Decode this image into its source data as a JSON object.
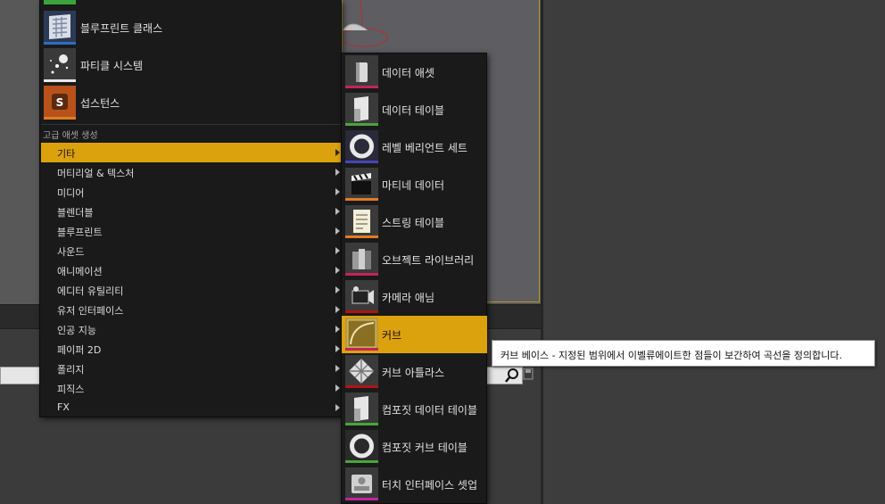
{
  "main_menu": {
    "assets": [
      {
        "label": "블루프린트 클래스",
        "icon": "blueprint-class-icon",
        "color": "#2f6cc8"
      },
      {
        "label": "파티클 시스템",
        "icon": "particle-system-icon",
        "color": "#e8e8e8"
      },
      {
        "label": "섭스턴스",
        "icon": "substance-icon",
        "color": "#e07d22"
      }
    ],
    "section_header": "고급 애셋 생성",
    "categories": [
      {
        "label": "기타",
        "active": true
      },
      {
        "label": "머티리얼 & 텍스처"
      },
      {
        "label": "미디어"
      },
      {
        "label": "블렌더블"
      },
      {
        "label": "블루프린트"
      },
      {
        "label": "사운드"
      },
      {
        "label": "애니메이션"
      },
      {
        "label": "에디터 유틸리티"
      },
      {
        "label": "유저 인터페이스"
      },
      {
        "label": "인공 지능"
      },
      {
        "label": "페이퍼 2D"
      },
      {
        "label": "폴리지"
      },
      {
        "label": "피직스"
      },
      {
        "label": "FX"
      }
    ]
  },
  "sub_menu": {
    "items": [
      {
        "label": "데이터 애셋",
        "icon": "data-asset-icon",
        "color": "#c2245c"
      },
      {
        "label": "데이터 테이블",
        "icon": "data-table-icon",
        "color": "#4aa43c"
      },
      {
        "label": "레벨 베리언트 세트",
        "icon": "level-variant-sets-icon",
        "color": "#4646b8"
      },
      {
        "label": "마티네 데이터",
        "icon": "matinee-data-icon",
        "color": "#e07d22"
      },
      {
        "label": "스트링 테이블",
        "icon": "string-table-icon",
        "color": "#e07d22"
      },
      {
        "label": "오브젝트 라이브러리",
        "icon": "object-library-icon",
        "color": "#c2245c"
      },
      {
        "label": "카메라 애님",
        "icon": "camera-anim-icon",
        "color": "#b01414"
      },
      {
        "label": "커브",
        "icon": "curve-icon",
        "color": "#c2245c",
        "active": true
      },
      {
        "label": "커브 아틀라스",
        "icon": "curve-atlas-icon",
        "color": "#b01414"
      },
      {
        "label": "컴포짓 데이터 테이블",
        "icon": "composite-data-table-icon",
        "color": "#4aa43c"
      },
      {
        "label": "컴포짓 커브 테이블",
        "icon": "composite-curve-table-icon",
        "color": "#4aa43c"
      },
      {
        "label": "터치 인터페이스 셋업",
        "icon": "touch-interface-setup-icon",
        "color": "#c2249c"
      }
    ]
  },
  "tooltip": {
    "text": "커브 베이스 - 지정된 범위에서 이벨류에이트한 점들이 보간하여 곡선을 정의합니다."
  },
  "accent_color": "#dca20e"
}
